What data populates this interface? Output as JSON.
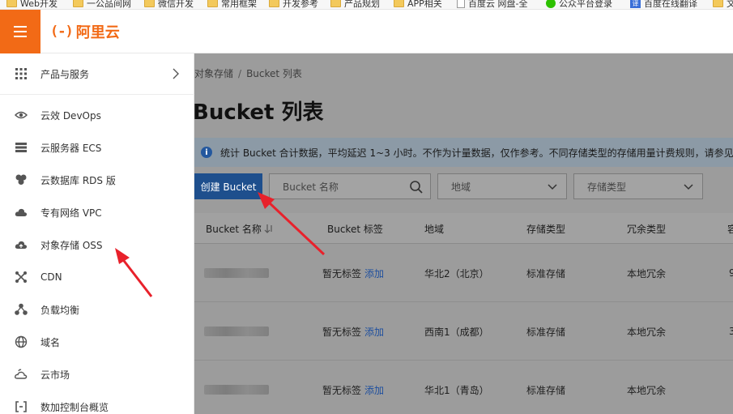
{
  "bookmarks": [
    {
      "label": "Web开发",
      "icon": "folder"
    },
    {
      "label": "一公品间网",
      "icon": "folder"
    },
    {
      "label": "微信开发",
      "icon": "folder"
    },
    {
      "label": "常用框架",
      "icon": "folder"
    },
    {
      "label": "开发参考",
      "icon": "folder"
    },
    {
      "label": "产品规划",
      "icon": "folder"
    },
    {
      "label": "APP相关",
      "icon": "folder"
    },
    {
      "label": "百度云 网盘-全",
      "icon": "page"
    },
    {
      "label": "公众平台登录",
      "icon": "wechat"
    },
    {
      "label": "百度在线翻译",
      "icon": "translate"
    },
    {
      "label": "文",
      "icon": "folder"
    }
  ],
  "header": {
    "logo_mark": "(-)",
    "logo_text": "阿里云"
  },
  "sidebar": {
    "products_label": "产品与服务",
    "items": [
      {
        "label": "云效 DevOps",
        "icon": "eye-icon"
      },
      {
        "label": "云服务器 ECS",
        "icon": "server-icon"
      },
      {
        "label": "云数据库 RDS 版",
        "icon": "database-icon"
      },
      {
        "label": "专有网络 VPC",
        "icon": "cloud-icon"
      },
      {
        "label": "对象存储 OSS",
        "icon": "cloud-storage-icon"
      },
      {
        "label": "CDN",
        "icon": "cdn-icon"
      },
      {
        "label": "负载均衡",
        "icon": "load-balancer-icon"
      },
      {
        "label": "域名",
        "icon": "globe-icon"
      },
      {
        "label": "云市场",
        "icon": "market-icon"
      },
      {
        "label": "数加控制台概览",
        "icon": "dataplus-icon"
      }
    ]
  },
  "breadcrumb": {
    "parent": "对象存储",
    "separator": "/",
    "current": "Bucket 列表"
  },
  "page_title": "Bucket 列表",
  "notice": "统计 Bucket 合计数据，平均延迟 1~3 小时。不作为计量数据，仅作参考。不同存储类型的存储用量计费规则，请参见帮",
  "toolbar": {
    "create_label": "创建 Bucket",
    "search_placeholder": "Bucket 名称",
    "region_select": "地域",
    "storage_select": "存储类型"
  },
  "table": {
    "headers": [
      "Bucket 名称",
      "Bucket 标签",
      "地域",
      "存储类型",
      "冗余类型",
      "容"
    ],
    "rows": [
      {
        "tag": "暂无标签",
        "add": "添加",
        "region": "华北2（北京）",
        "storage": "标准存储",
        "redundancy": "本地冗余",
        "extra": "9"
      },
      {
        "tag": "暂无标签",
        "add": "添加",
        "region": "西南1（成都）",
        "storage": "标准存储",
        "redundancy": "本地冗余",
        "extra": "3"
      },
      {
        "tag": "暂无标签",
        "add": "添加",
        "region": "华北1（青岛）",
        "storage": "标准存储",
        "redundancy": "本地冗余",
        "extra": ""
      }
    ]
  },
  "colors": {
    "brand_orange": "#f26a16",
    "annotation_red": "#e8212b",
    "primary_blue": "#1e4f8d"
  }
}
